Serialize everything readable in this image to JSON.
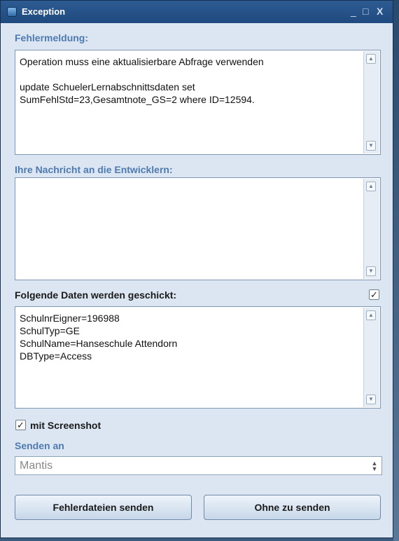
{
  "window": {
    "title": "Exception",
    "controls": {
      "minimize": "_",
      "maximize": "□",
      "close": "X"
    }
  },
  "error_section": {
    "label": "Fehlermeldung:",
    "text": "Operation muss eine aktualisierbare Abfrage verwenden\n\nupdate SchuelerLernabschnittsdaten set\nSumFehlStd=23,Gesamtnote_GS=2 where ID=12594."
  },
  "message_section": {
    "label": "Ihre Nachricht an die Entwicklern:",
    "text": ""
  },
  "data_section": {
    "label": "Folgende Daten werden geschickt:",
    "checked": true,
    "checkmark": "✓",
    "text": "SchulnrEigner=196988\nSchulTyp=GE\nSchulName=Hanseschule Attendorn\nDBType=Access"
  },
  "screenshot_option": {
    "label": "mit Screenshot",
    "checked": true,
    "checkmark": "✓"
  },
  "send_to": {
    "label": "Senden an",
    "selected": "Mantis"
  },
  "buttons": {
    "send": "Fehlerdateien senden",
    "no_send": "Ohne zu senden"
  },
  "scroll_arrows": {
    "up": "▲",
    "down": "▼"
  },
  "select_arrows": {
    "up": "▲",
    "down": "▼"
  }
}
